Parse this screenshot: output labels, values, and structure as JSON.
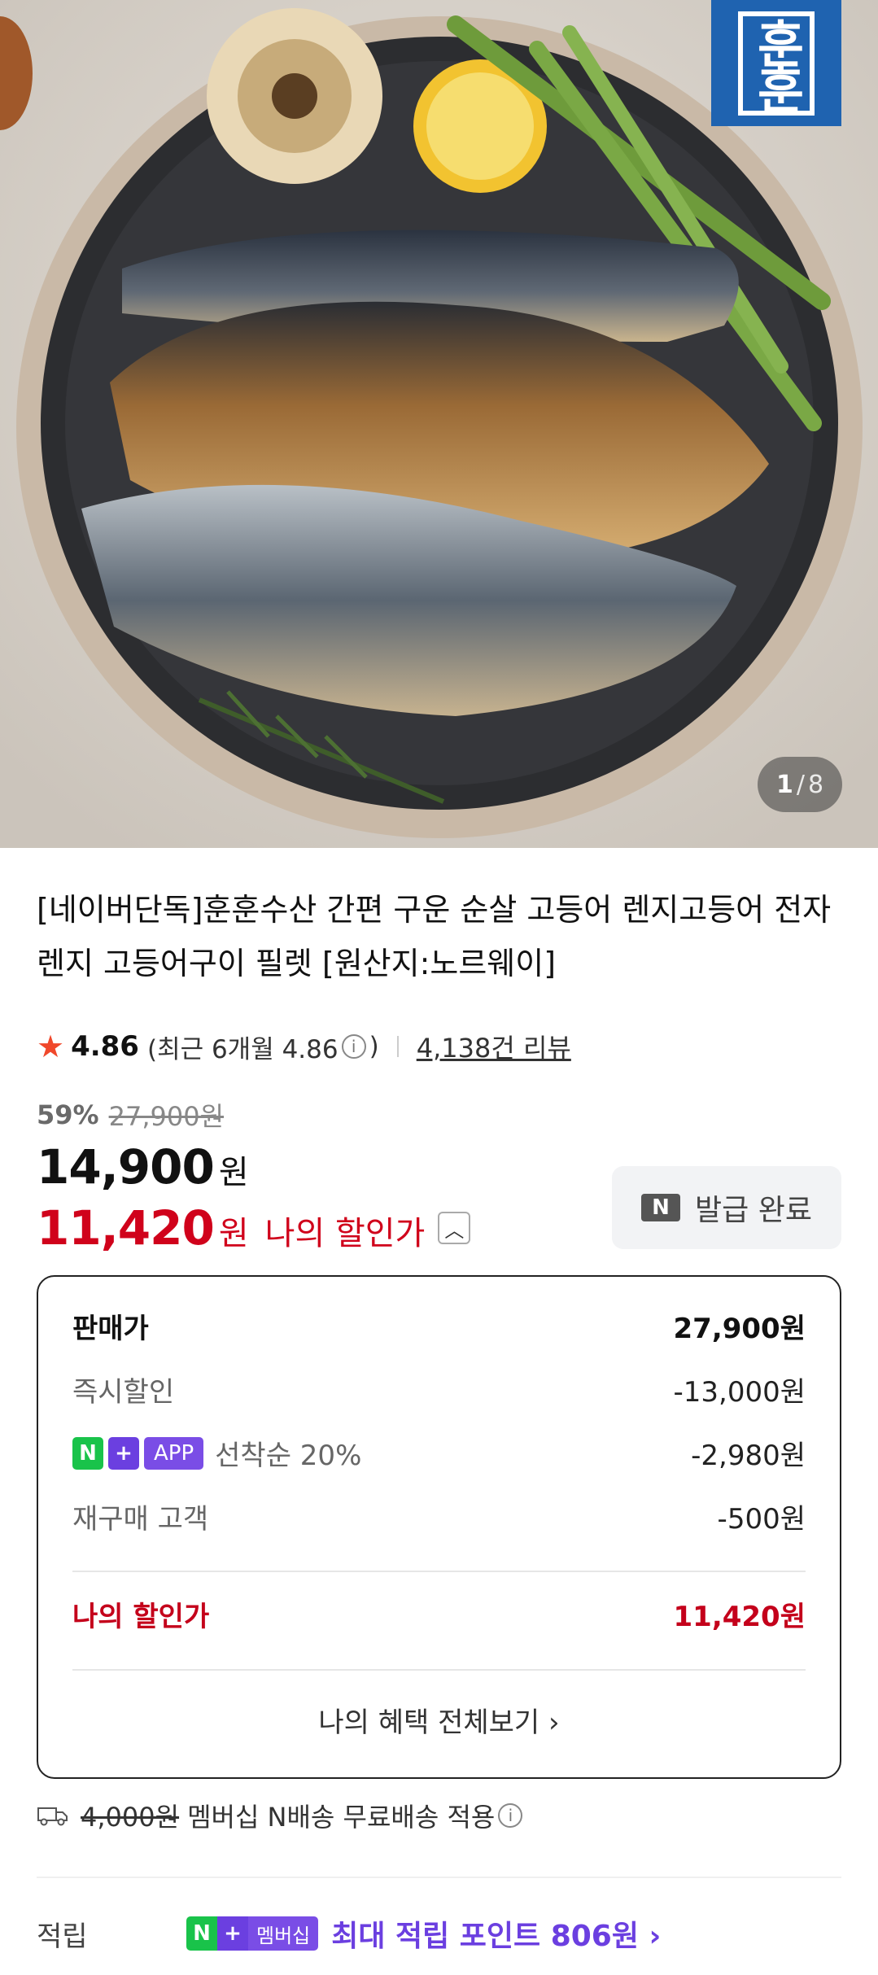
{
  "hero": {
    "brand_logo": "훈훈",
    "page_current": "1",
    "page_separator": "/",
    "page_total": "8"
  },
  "product": {
    "title": "[네이버단독]훈훈수산 간편 구운 순살 고등어 렌지고등어 전자렌지 고등어구이 필렛 [원산지:노르웨이]",
    "rating": "4.86",
    "rating_recent": "(최근 6개월 4.86",
    "rating_recent_close": ")",
    "info_glyph": "i",
    "review_count": "4,138건 리뷰"
  },
  "price": {
    "discount_rate": "59%",
    "original_price": "27,900원",
    "sale_price": "14,900",
    "won": "원",
    "my_price": "11,420",
    "my_price_label": "나의 할인가",
    "coupon_badge": "N",
    "coupon_label": "발급 완료"
  },
  "price_box": {
    "rows": [
      {
        "label": "판매가",
        "value": "27,900원"
      },
      {
        "label": "즉시할인",
        "value": "-13,000원"
      },
      {
        "badge_n": "N",
        "badge_plus": "+",
        "badge_app": "APP",
        "label": "선착순 20%",
        "value": "-2,980원"
      },
      {
        "label": "재구매 고객",
        "value": "-500원"
      }
    ],
    "total_label": "나의 할인가",
    "total_value": "11,420원",
    "benefit_link": "나의 혜택 전체보기 ›"
  },
  "shipping": {
    "strike_fee": "4,000원",
    "text": "멤버십 N배송 무료배송 적용"
  },
  "points": {
    "label": "적립",
    "badge_n": "N",
    "badge_plus": "+",
    "badge_membership": "멤버십",
    "text": "최대 적립 포인트 806원 ›"
  },
  "colors": {
    "accent_red": "#c4001b",
    "naver_green": "#19c34a",
    "membership_purple": "#6b3fe0",
    "star": "#f0482b"
  }
}
